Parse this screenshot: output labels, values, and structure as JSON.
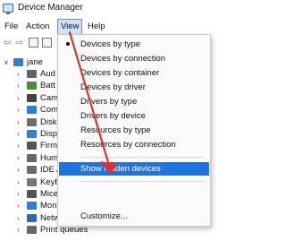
{
  "window": {
    "title": "Device Manager",
    "app_icon": "device-manager-icon"
  },
  "menubar": {
    "items": [
      "File",
      "Action",
      "View",
      "Help"
    ]
  },
  "toolbar": {
    "icons": [
      "back-arrow-icon",
      "forward-arrow-icon",
      "properties-icon",
      "help-icon"
    ]
  },
  "tree": {
    "root": "jane",
    "items": [
      {
        "label": "Aud",
        "icon": "audio-icon",
        "color": "#5b6470"
      },
      {
        "label": "Batt",
        "icon": "battery-icon",
        "color": "#4a8f3a"
      },
      {
        "label": "Cam",
        "icon": "camera-icon",
        "color": "#444444"
      },
      {
        "label": "Com",
        "icon": "computer-icon",
        "color": "#2d7fd8"
      },
      {
        "label": "Disk",
        "icon": "disk-icon",
        "color": "#6d6d6d"
      },
      {
        "label": "Disp",
        "icon": "display-icon",
        "color": "#2d7fd8"
      },
      {
        "label": "Firm",
        "icon": "firmware-icon",
        "color": "#555555"
      },
      {
        "label": "Hum",
        "icon": "human-interface-icon",
        "color": "#666666"
      },
      {
        "label": "IDE A",
        "icon": "ide-icon",
        "color": "#6b6b6b"
      },
      {
        "label": "Keyb",
        "icon": "keyboard-icon",
        "color": "#777777"
      },
      {
        "label": "Mice",
        "icon": "mouse-icon",
        "color": "#555555"
      },
      {
        "label": "Monitors",
        "icon": "monitor-icon",
        "color": "#2d7fd8"
      },
      {
        "label": "Network adapters",
        "icon": "network-adapter-icon",
        "color": "#2b6cb0"
      },
      {
        "label": "Print queues",
        "icon": "printer-icon",
        "color": "#666666"
      }
    ]
  },
  "view_menu": {
    "items": [
      {
        "label": "Devices by type",
        "checked": true
      },
      {
        "label": "Devices by connection"
      },
      {
        "label": "Devices by container"
      },
      {
        "label": "Devices by driver"
      },
      {
        "label": "Drivers by type"
      },
      {
        "label": "Drivers by device"
      },
      {
        "label": "Resources by type"
      },
      {
        "label": "Resources by connection"
      },
      {
        "label": "Show hidden devices",
        "highlighted": true
      },
      {
        "label": "Customize..."
      }
    ]
  },
  "annotation": {
    "arrow_color": "#e0302e"
  }
}
